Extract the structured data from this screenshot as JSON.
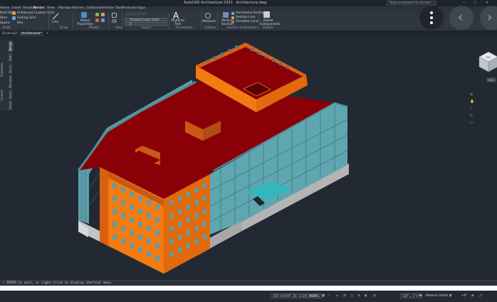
{
  "app": {
    "title": "AutoCAD Architecture 2021",
    "file": "Architecture.dwg",
    "search_placeholder": "Type a keyword or phrase"
  },
  "ribbon_tabs": [
    "Home",
    "Insert",
    "Annotate",
    "Render",
    "View",
    "Manage",
    "Add-ins",
    "Collaborate",
    "Vision Tools",
    "Featured Apps"
  ],
  "ribbon": {
    "build": [
      "Roof Slab",
      "Enhanced Custom Grid",
      "Stair",
      "Ceiling Grid",
      "Space",
      "Box"
    ],
    "draw": "Line",
    "match": [
      "Match",
      "Properties"
    ],
    "layer_combo": "Unsaved Layer State",
    "layer_value": "0",
    "annotation": [
      "Multiline",
      "Text"
    ],
    "measure": "Measure",
    "vertical_section": [
      "Vertical",
      "Section"
    ],
    "sections": [
      "Horizontal Section",
      "Section Line",
      "Elevation Line"
    ],
    "detail": [
      "Detail",
      "Components"
    ],
    "groups": [
      "Build",
      "Draw",
      "Modify",
      "View",
      "Layers",
      "Annotation",
      "Utilities",
      "Section & Elevation",
      "Details"
    ]
  },
  "doc_tabs": [
    "Drawing1*",
    "Architecture*"
  ],
  "palette_tabs": [
    "Design",
    "Walls",
    "Doors",
    "Windows",
    "Stairs",
    "Detail"
  ],
  "palette_edge": [
    "Properties",
    "Content"
  ],
  "viewcube": {
    "face": "TOP",
    "label": "WCS"
  },
  "command_line": "r ENTER to exit, or right-click to display shortcut menu.",
  "status": {
    "coords": "335'-4 9/16\", 81'-3 3/4\", 0'-0\"",
    "model": "MODEL",
    "scale": "1/8\" = 1'-0\"",
    "detail": "Medium Detail",
    "elev": "+0\""
  },
  "colors": {
    "roof": "#8a0006",
    "brick": "#f47a12",
    "glass": "#58a4ae",
    "concrete": "#b4b4b4",
    "viewport": "#222933"
  }
}
